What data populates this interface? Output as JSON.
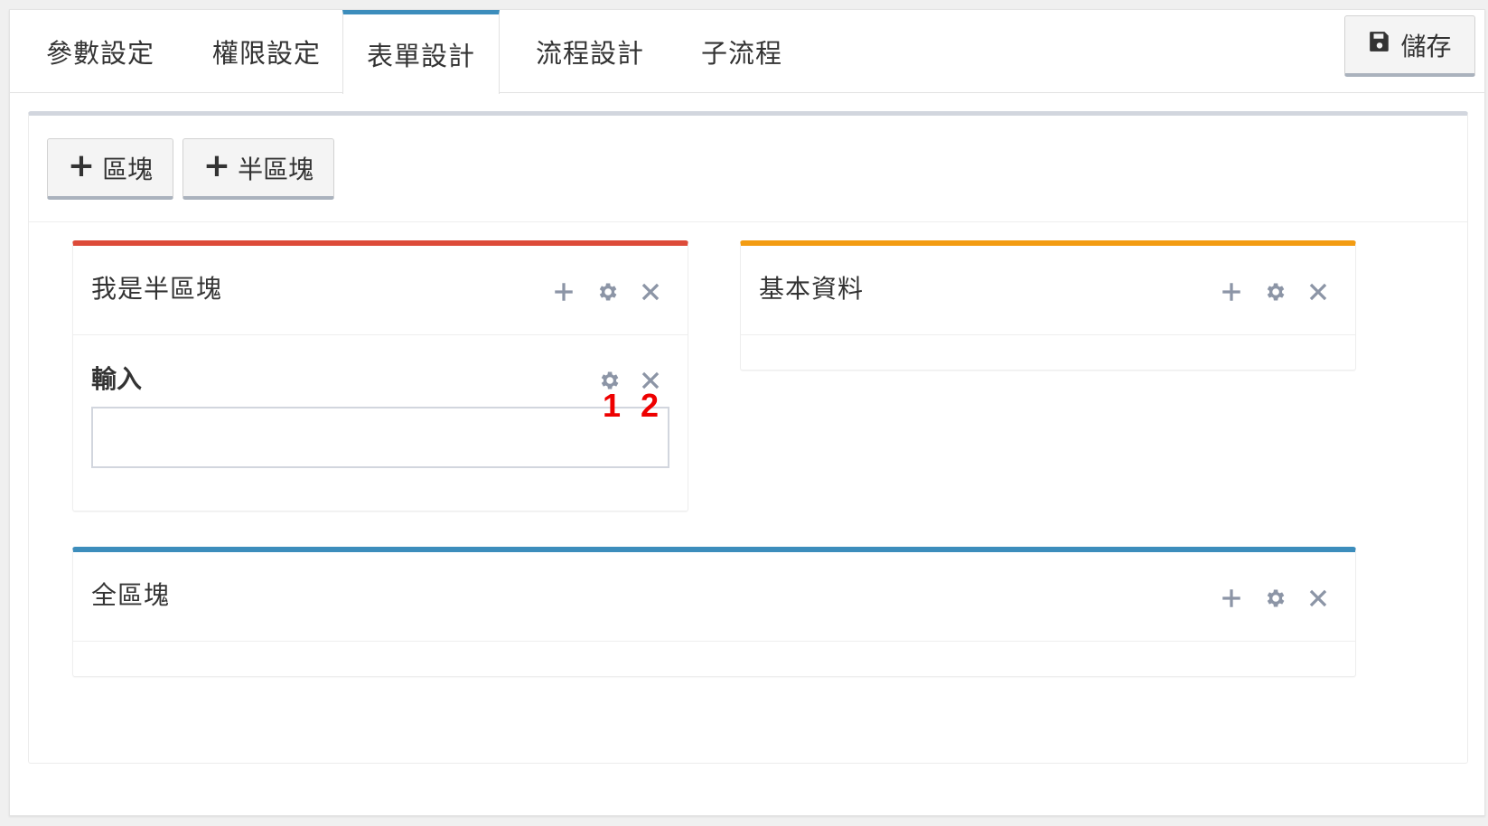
{
  "tabs": [
    {
      "label": "參數設定",
      "active": false
    },
    {
      "label": "權限設定",
      "active": false
    },
    {
      "label": "表單設計",
      "active": true
    },
    {
      "label": "流程設計",
      "active": false
    },
    {
      "label": "子流程",
      "active": false
    }
  ],
  "save_button": {
    "label": "儲存",
    "icon": "floppy-disk-icon"
  },
  "toolbar": {
    "add_block_label": "區塊",
    "add_half_block_label": "半區塊"
  },
  "panels": {
    "half_block": {
      "title": "我是半區塊",
      "accent": "#dd4b39"
    },
    "basic_info": {
      "title": "基本資料",
      "accent": "#f39c12"
    },
    "full_block": {
      "title": "全區塊",
      "accent": "#3c8dbc"
    }
  },
  "field": {
    "label": "輸入",
    "value": ""
  },
  "markers": [
    "1",
    "2"
  ],
  "colors": {
    "tab_active_accent": "#3c8dbc",
    "icon_gray": "#8c95a6",
    "marker_red": "#ee0000"
  }
}
